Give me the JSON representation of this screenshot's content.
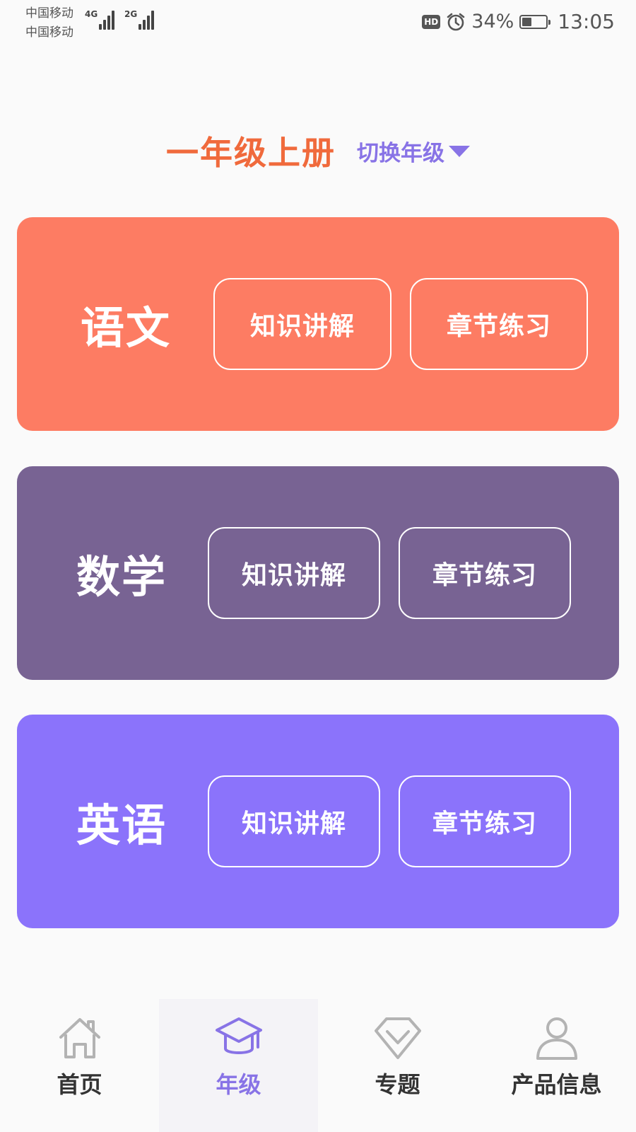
{
  "status_bar": {
    "carrier_1": "中国移动",
    "carrier_2": "中国移动",
    "network_1": "4G",
    "network_2": "2G",
    "hd_badge": "HD",
    "battery_percent": "34%",
    "battery_level": 0.34,
    "time": "13:05"
  },
  "header": {
    "grade_title": "一年级上册",
    "switch_grade_label": "切换年级"
  },
  "subjects": [
    {
      "name": "语文",
      "explain_label": "知识讲解",
      "practice_label": "章节练习",
      "color": "#fd7c63"
    },
    {
      "name": "数学",
      "explain_label": "知识讲解",
      "practice_label": "章节练习",
      "color": "#786393"
    },
    {
      "name": "英语",
      "explain_label": "知识讲解",
      "practice_label": "章节练习",
      "color": "#8b73fb"
    }
  ],
  "nav": {
    "items": [
      {
        "label": "首页",
        "icon": "home-icon"
      },
      {
        "label": "年级",
        "icon": "graduation-cap-icon",
        "active": true
      },
      {
        "label": "专题",
        "icon": "topic-icon"
      },
      {
        "label": "产品信息",
        "icon": "user-icon"
      }
    ]
  },
  "colors": {
    "accent": "#8873e6",
    "title": "#f06a3c",
    "nav_text": "#333333",
    "icon_gray": "#b3b3b3"
  }
}
